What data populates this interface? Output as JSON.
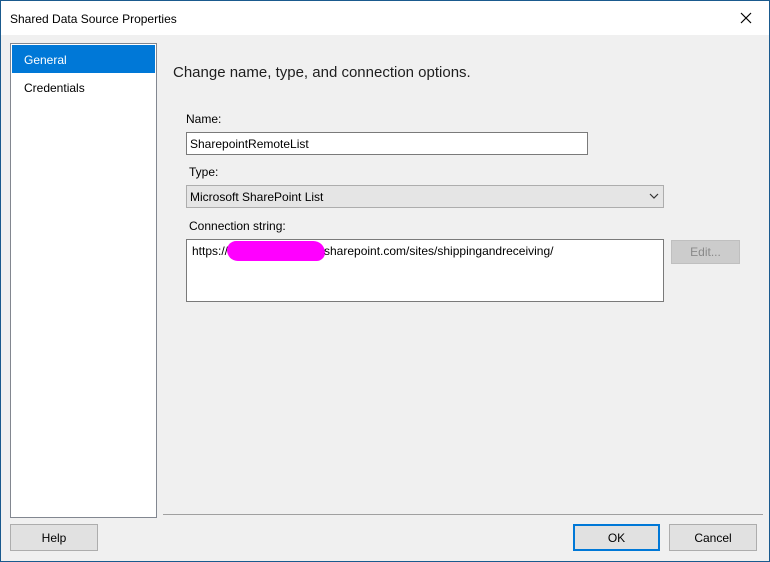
{
  "window": {
    "title": "Shared Data Source Properties"
  },
  "nav": {
    "items": [
      {
        "label": "General",
        "selected": true
      },
      {
        "label": "Credentials",
        "selected": false
      }
    ]
  },
  "general": {
    "heading": "Change name, type, and connection options.",
    "name_label": "Name:",
    "name_value": "SharepointRemoteList",
    "type_label": "Type:",
    "type_value": "Microsoft SharePoint List",
    "connection_label": "Connection string:",
    "connection_prefix": "https://",
    "connection_suffix": "sharepoint.com/sites/shippingandreceiving/",
    "edit_label": "Edit..."
  },
  "footer": {
    "help_label": "Help",
    "ok_label": "OK",
    "cancel_label": "Cancel"
  },
  "colors": {
    "accent": "#0078d7",
    "redaction": "#ff00ff"
  },
  "icons": {
    "close": "close-icon",
    "dropdown": "chevron-down-icon"
  }
}
